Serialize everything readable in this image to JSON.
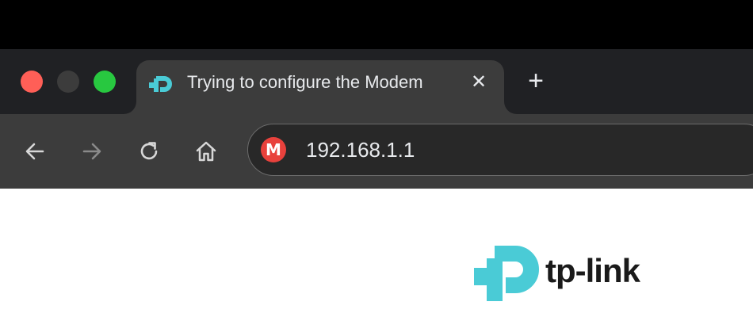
{
  "browser": {
    "tab": {
      "title": "Trying to configure the Modem",
      "favicon": "tp-link-icon",
      "close_glyph": "✕"
    },
    "new_tab_glyph": "+",
    "toolbar": {
      "back_icon": "back-arrow-icon",
      "forward_icon": "forward-arrow-icon",
      "reload_icon": "reload-icon",
      "home_icon": "home-icon"
    },
    "address_bar": {
      "site_icon_letter": "M",
      "url": "192.168.1.1"
    }
  },
  "page": {
    "logo_text": "tp-link"
  },
  "colors": {
    "chrome_dark": "#202124",
    "toolbar": "#3c3c3c",
    "accent_teal": "#4acbd6",
    "close_red": "#ff5f57",
    "maximize_green": "#28c840",
    "site_icon_red": "#e8413c"
  }
}
